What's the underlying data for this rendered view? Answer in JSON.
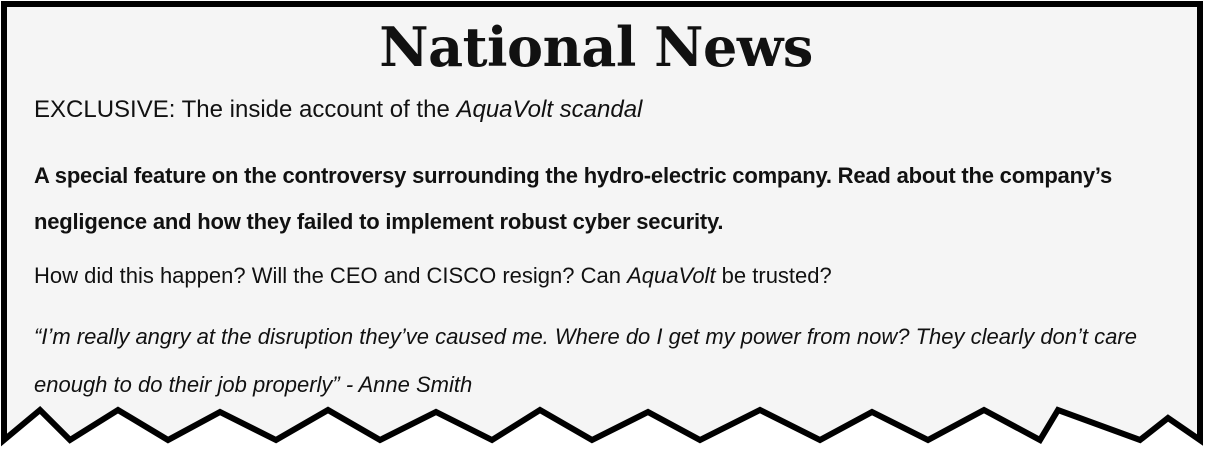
{
  "masthead": "National News",
  "headline": {
    "prefix": "EXCLUSIVE: The inside account of the ",
    "emphasis": "AquaVolt scandal"
  },
  "feature_text": "A special feature on the controversy surrounding the hydro-electric company. Read about the company’s negligence and how they failed to implement robust cyber security.",
  "questions": {
    "before": "How did this happen? Will the CEO and CISCO resign? Can ",
    "company": "AquaVolt",
    "after": " be trusted?"
  },
  "quote": "“I’m really angry at the disruption they’ve caused me. Where do I get my power from now? They clearly don’t care enough to do their job properly” - Anne Smith",
  "colors": {
    "paper": "#f5f5f5",
    "border": "#000000",
    "text": "#111111"
  }
}
